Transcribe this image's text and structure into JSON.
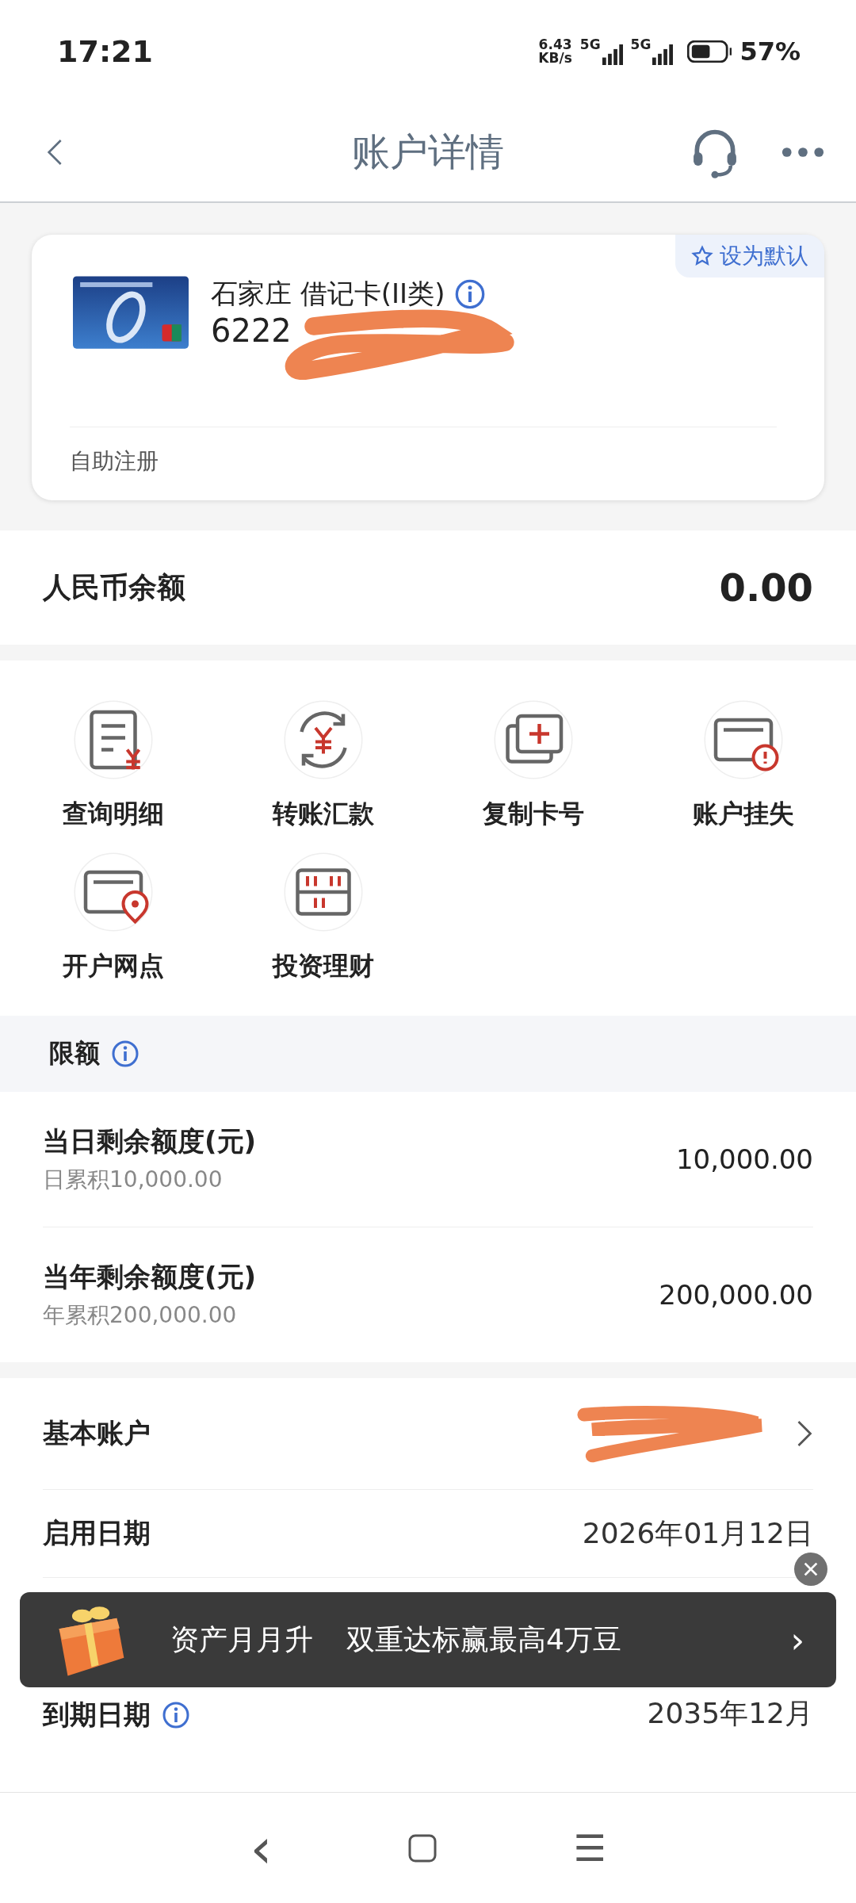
{
  "status_bar": {
    "time": "17:21",
    "net_speed": "6.43",
    "net_unit": "KB/s",
    "sim1": "5G",
    "sim2": "5G",
    "battery": "57%"
  },
  "header": {
    "title": "账户详情"
  },
  "card": {
    "name": "石家庄 借记卡(II类)",
    "number": "6222",
    "default_label": "设为默认",
    "footer": "自助注册"
  },
  "balance": {
    "label": "人民币余额",
    "value": "0.00"
  },
  "actions": [
    {
      "label": "查询明细"
    },
    {
      "label": "转账汇款"
    },
    {
      "label": "复制卡号"
    },
    {
      "label": "账户挂失"
    },
    {
      "label": "开户网点"
    },
    {
      "label": "投资理财"
    }
  ],
  "limits": {
    "title": "限额",
    "rows": [
      {
        "label": "当日剩余额度(元)",
        "sub": "日累积10,000.00",
        "value": "10,000.00"
      },
      {
        "label": "当年剩余额度(元)",
        "sub": "年累积200,000.00",
        "value": "200,000.00"
      }
    ]
  },
  "details": [
    {
      "kind": "link",
      "label": "基本账户"
    },
    {
      "kind": "plain",
      "label": "启用日期",
      "value": "2026年01月12日"
    },
    {
      "kind": "info",
      "label": "到期日期",
      "value": "2035年12月"
    }
  ],
  "promo": {
    "title": "资产月月升",
    "text": "双重达标赢最高4万豆",
    "arrow": "›"
  },
  "nav_bar": {
    "back": "‹",
    "menu": "☰"
  }
}
